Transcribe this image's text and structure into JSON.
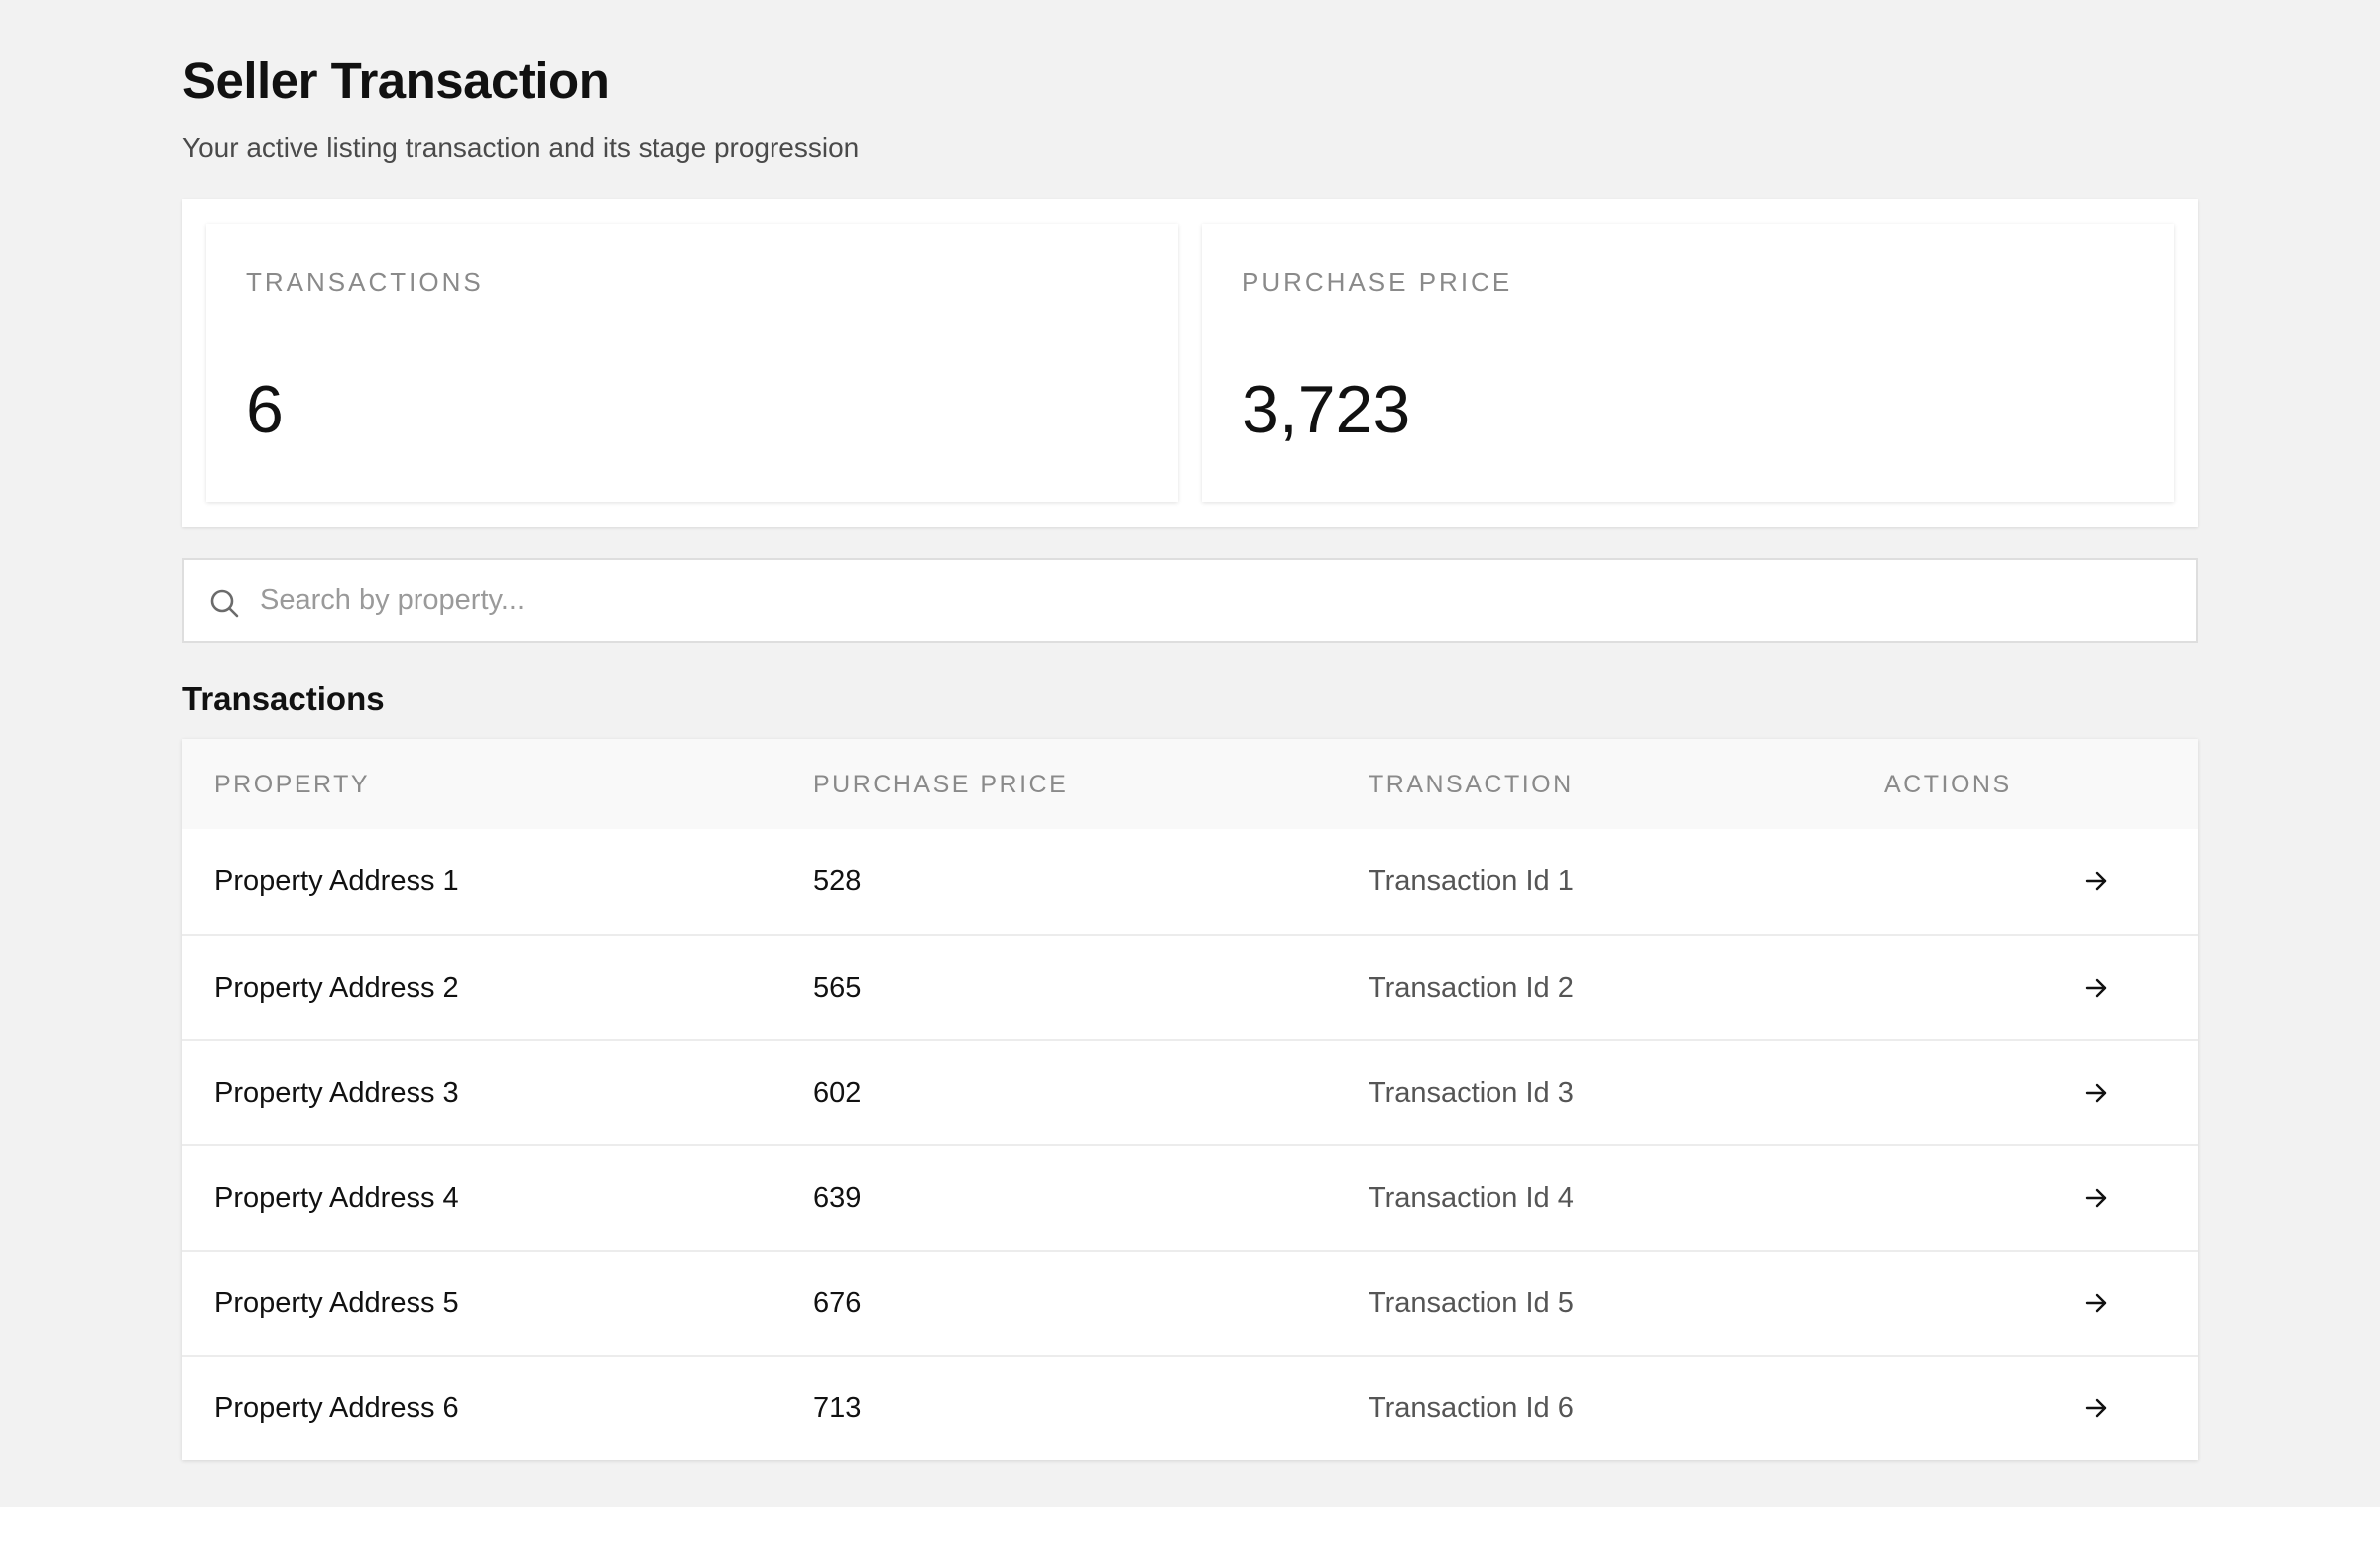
{
  "header": {
    "title": "Seller Transaction",
    "subtitle": "Your active listing transaction and its stage progression"
  },
  "stats": [
    {
      "label": "TRANSACTIONS",
      "value": "6"
    },
    {
      "label": "PURCHASE PRICE",
      "value": "3,723"
    }
  ],
  "search": {
    "placeholder": "Search by property...",
    "value": "",
    "icon": "search-icon"
  },
  "transactions": {
    "section_title": "Transactions",
    "columns": [
      "PROPERTY",
      "PURCHASE PRICE",
      "TRANSACTION",
      "ACTIONS"
    ],
    "rows": [
      {
        "property": "Property Address 1",
        "price": "528",
        "transaction": "Transaction Id 1",
        "action_icon": "arrow-right-icon"
      },
      {
        "property": "Property Address 2",
        "price": "565",
        "transaction": "Transaction Id 2",
        "action_icon": "arrow-right-icon"
      },
      {
        "property": "Property Address 3",
        "price": "602",
        "transaction": "Transaction Id 3",
        "action_icon": "arrow-right-icon"
      },
      {
        "property": "Property Address 4",
        "price": "639",
        "transaction": "Transaction Id 4",
        "action_icon": "arrow-right-icon"
      },
      {
        "property": "Property Address 5",
        "price": "676",
        "transaction": "Transaction Id 5",
        "action_icon": "arrow-right-icon"
      },
      {
        "property": "Property Address 6",
        "price": "713",
        "transaction": "Transaction Id 6",
        "action_icon": "arrow-right-icon"
      }
    ]
  },
  "colors": {
    "page_background": "#f2f2f2",
    "card_background": "#ffffff",
    "muted_label": "#8a8a8a",
    "text_primary": "#111111"
  }
}
